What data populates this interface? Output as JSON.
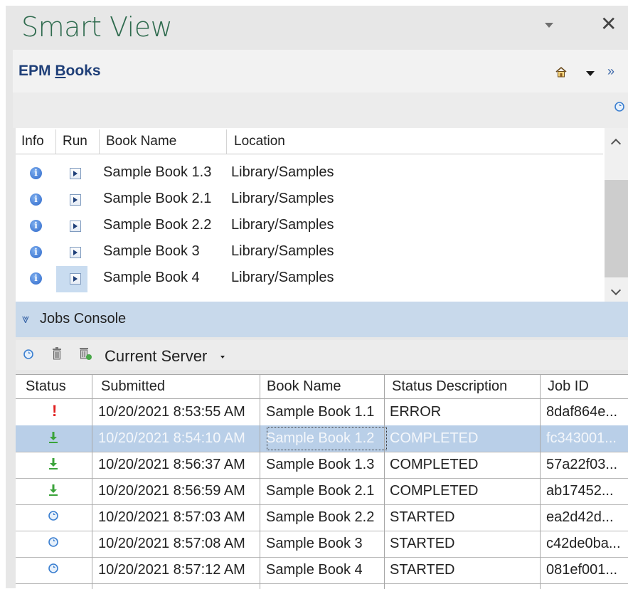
{
  "panel": {
    "title": "Smart View"
  },
  "epm": {
    "title_prefix": "EPM ",
    "title_underlined": "B",
    "title_rest": "ooks"
  },
  "books_table": {
    "columns": [
      "Info",
      "Run",
      "Book Name",
      "Location"
    ],
    "rows": [
      {
        "name": "Sample Book 1.3",
        "location": "Library/Samples",
        "run_selected": false
      },
      {
        "name": "Sample Book 2.1",
        "location": "Library/Samples",
        "run_selected": false
      },
      {
        "name": "Sample Book 2.2",
        "location": "Library/Samples",
        "run_selected": false
      },
      {
        "name": "Sample Book 3",
        "location": "Library/Samples",
        "run_selected": false
      },
      {
        "name": "Sample Book 4",
        "location": "Library/Samples",
        "run_selected": true
      }
    ]
  },
  "jobs_console": {
    "label": "Jobs Console",
    "server_label": "Current Server",
    "columns": [
      "Status",
      "Submitted",
      "Book Name",
      "Status Description",
      "Job ID"
    ],
    "rows": [
      {
        "status": "error",
        "status_glyph": "!",
        "submitted": "10/20/2021 8:53:55 AM",
        "book": "Sample Book 1.1",
        "description": "ERROR",
        "job_id": "8daf864e...",
        "selected": false
      },
      {
        "status": "completed",
        "submitted": "10/20/2021 8:54:10 AM",
        "book": "Sample Book 1.2",
        "description": "COMPLETED",
        "job_id": "fc343001...",
        "selected": true
      },
      {
        "status": "completed",
        "submitted": "10/20/2021 8:56:37 AM",
        "book": "Sample Book 1.3",
        "description": "COMPLETED",
        "job_id": "57a22f03...",
        "selected": false
      },
      {
        "status": "completed",
        "submitted": "10/20/2021 8:56:59 AM",
        "book": "Sample Book 2.1",
        "description": "COMPLETED",
        "job_id": "ab17452...",
        "selected": false
      },
      {
        "status": "started",
        "submitted": "10/20/2021 8:57:03 AM",
        "book": "Sample Book 2.2",
        "description": "STARTED",
        "job_id": "ea2d42d...",
        "selected": false
      },
      {
        "status": "started",
        "submitted": "10/20/2021 8:57:08 AM",
        "book": "Sample Book 3",
        "description": "STARTED",
        "job_id": "c42de0ba...",
        "selected": false
      },
      {
        "status": "started",
        "submitted": "10/20/2021 8:57:12 AM",
        "book": "Sample Book 4",
        "description": "STARTED",
        "job_id": "081ef001...",
        "selected": false
      }
    ]
  },
  "icons": {
    "title_dropdown": "caret-down-icon",
    "close": "close-icon",
    "home": "home-icon",
    "epm_menu": "caret-down-icon",
    "expand": "double-chevron-right-icon",
    "refresh": "refresh-icon",
    "delete": "trash-icon",
    "delete_all": "trash-all-icon",
    "completed": "download-icon",
    "started": "refresh-icon",
    "error": "exclamation-icon"
  },
  "colors": {
    "title": "#2f6b4e",
    "epm_title": "#1f3f78",
    "jobs_header_bg": "#c8d9eb",
    "selected_row": "#b9cfe8",
    "error": "#e02020",
    "completed": "#3aa33a",
    "started": "#3b7fd0"
  }
}
